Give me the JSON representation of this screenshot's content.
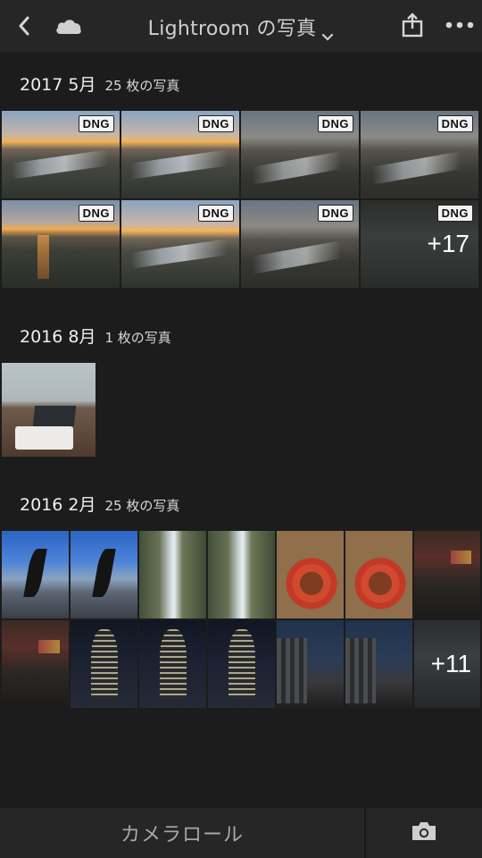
{
  "header": {
    "title": "Lightroom の写真"
  },
  "sections": [
    {
      "date": "2017 5月",
      "count": "25 枚の写真",
      "badge": "DNG",
      "more": "+17"
    },
    {
      "date": "2016 8月",
      "count": "1 枚の写真"
    },
    {
      "date": "2016 2月",
      "count": "25 枚の写真",
      "more": "+11"
    }
  ],
  "bottom": {
    "camera_roll_label": "カメラロール"
  },
  "icons": {
    "back": "chevron-left-icon",
    "cloud": "cloud-icon",
    "dropdown": "chevron-down-icon",
    "share": "share-icon",
    "more": "more-horizontal-icon",
    "camera": "camera-icon"
  },
  "colors": {
    "background": "#1c1c1c",
    "bar": "#262626",
    "badge_bg": "#f4f4f4"
  }
}
